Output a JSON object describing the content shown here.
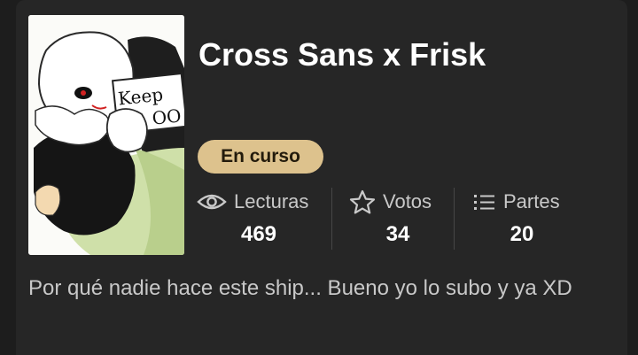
{
  "story": {
    "title": "Cross Sans x Frisk",
    "status": "En curso",
    "cover_text": "Keep",
    "cover_text_2": "OO",
    "description": "Por qué nadie hace este ship... Bueno yo lo subo y ya XD"
  },
  "stats": {
    "reads": {
      "label": "Lecturas",
      "value": "469",
      "icon": "eye-icon"
    },
    "votes": {
      "label": "Votos",
      "value": "34",
      "icon": "star-icon"
    },
    "parts": {
      "label": "Partes",
      "value": "20",
      "icon": "list-icon"
    }
  },
  "colors": {
    "background": "#1d1d1d",
    "card": "#262626",
    "badge": "#ddc28d",
    "badge_text": "#231b0c",
    "text_primary": "#ffffff",
    "text_secondary": "#c8c8c8"
  }
}
